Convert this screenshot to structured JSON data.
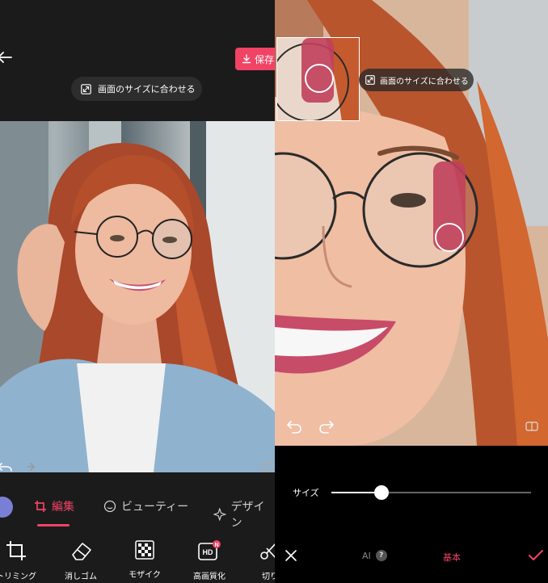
{
  "colors": {
    "accent": "#f04365",
    "dark_bg": "#1b1b1b",
    "black_bg": "#000000",
    "pill_bg": "#2d2d2d"
  },
  "left": {
    "header": {
      "save_label": "保存",
      "fit_to_screen_label": "画面のサイズに合わせる"
    },
    "tabs": [
      {
        "label": "編集",
        "icon": "crop-icon",
        "active": true
      },
      {
        "label": "ビューティー",
        "icon": "face-smile-icon",
        "active": false
      },
      {
        "label": "デザイン",
        "icon": "sparkle-icon",
        "active": false
      }
    ],
    "tools": [
      {
        "label": "トリミング",
        "icon": "crop-icon"
      },
      {
        "label": "消しゴム",
        "icon": "eraser-icon"
      },
      {
        "label": "モザイク",
        "icon": "mosaic-icon"
      },
      {
        "label": "高画質化",
        "icon": "hd-icon",
        "badge": "N"
      },
      {
        "label": "切り",
        "icon": "scissors-icon"
      }
    ]
  },
  "right": {
    "fit_to_screen_label": "画面のサイズに合わせる",
    "size_label": "サイズ",
    "size_value": 0.25,
    "bottom": {
      "ai_label": "AI",
      "help_badge": "?",
      "basic_label": "基本"
    }
  }
}
